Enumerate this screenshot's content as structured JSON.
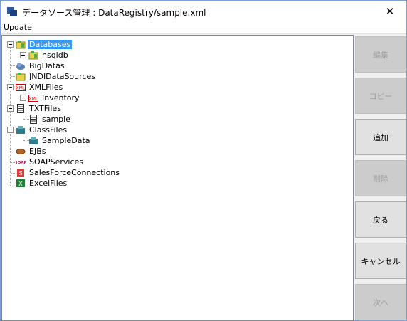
{
  "window": {
    "title": "データソース管理 : DataRegistry/sample.xml",
    "close_glyph": "✕"
  },
  "menu": {
    "update": "Update"
  },
  "tree": {
    "databases": "Databases",
    "hsqldb": "hsqldb",
    "bigdatas": "BigDatas",
    "jndi": "JNDIDataSources",
    "xmlfiles": "XMLFiles",
    "inventory": "Inventory",
    "txtfiles": "TXTFiles",
    "sample": "sample",
    "classfiles": "ClassFiles",
    "sampledata": "SampleData",
    "ejbs": "EJBs",
    "soap": "SOAPServices",
    "salesforce": "SalesForceConnections",
    "excel": "ExcelFiles",
    "selected": "Databases"
  },
  "buttons": {
    "edit": "編集",
    "copy": "コピー",
    "add": "追加",
    "delete": "削除",
    "back": "戻る",
    "cancel": "キャンセル",
    "next": "次へ"
  },
  "colors": {
    "selection": "#3399ff",
    "disabled_text": "#a0a0a0"
  }
}
